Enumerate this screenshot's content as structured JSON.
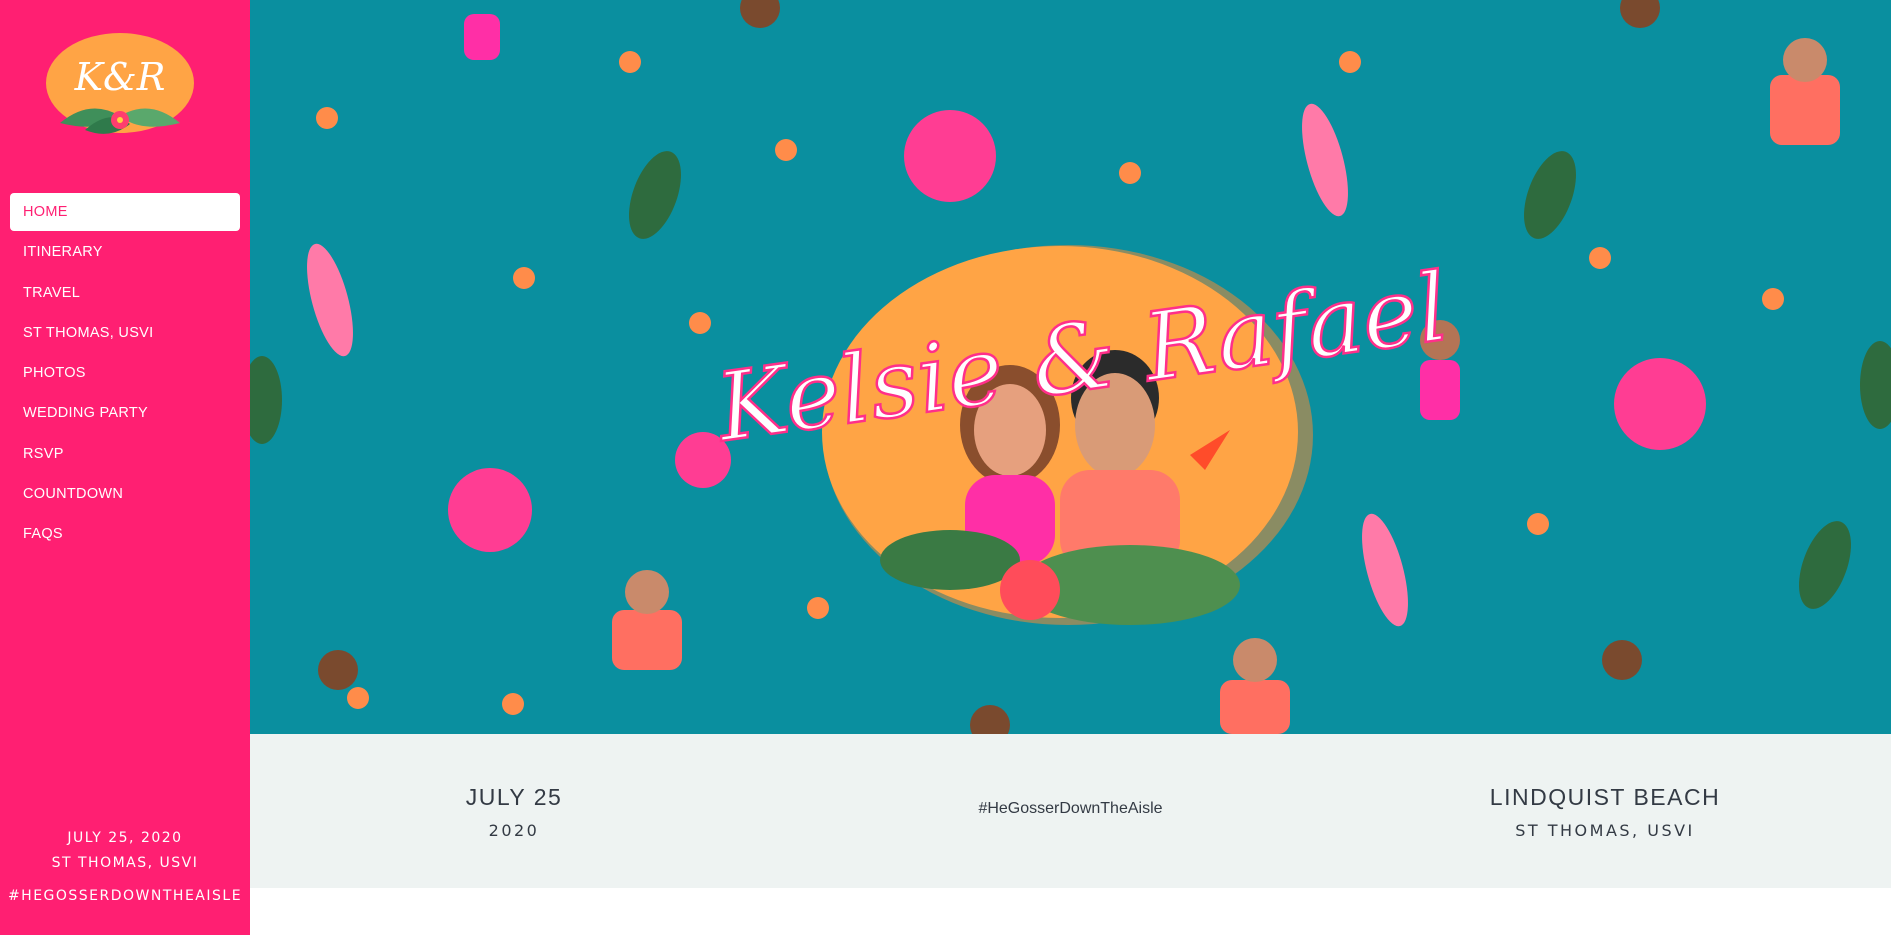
{
  "sidebar": {
    "logo_text": "K&R",
    "nav": [
      {
        "label": "HOME",
        "active": true
      },
      {
        "label": "ITINERARY",
        "active": false
      },
      {
        "label": "TRAVEL",
        "active": false
      },
      {
        "label": "ST THOMAS, USVI",
        "active": false
      },
      {
        "label": "PHOTOS",
        "active": false
      },
      {
        "label": "WEDDING PARTY",
        "active": false
      },
      {
        "label": "RSVP",
        "active": false
      },
      {
        "label": "COUNTDOWN",
        "active": false
      },
      {
        "label": "FAQS",
        "active": false
      }
    ],
    "footer": {
      "date": "JULY 25, 2020",
      "location": "ST THOMAS, USVI",
      "hashtag": "#HEGOSSERDOWNTHEAISLE"
    }
  },
  "hero": {
    "script_title": "Kelsie & Rafael"
  },
  "info": {
    "left_big": "JULY 25",
    "left_small": "2020",
    "middle": "#HeGosserDownTheAisle",
    "right_big": "LINDQUIST BEACH",
    "right_small": "ST THOMAS, USVI"
  },
  "colors": {
    "brand_pink": "#ff1f72",
    "teal": "#0a8f9f",
    "orange": "#ffa445",
    "strip": "#eef3f2"
  }
}
